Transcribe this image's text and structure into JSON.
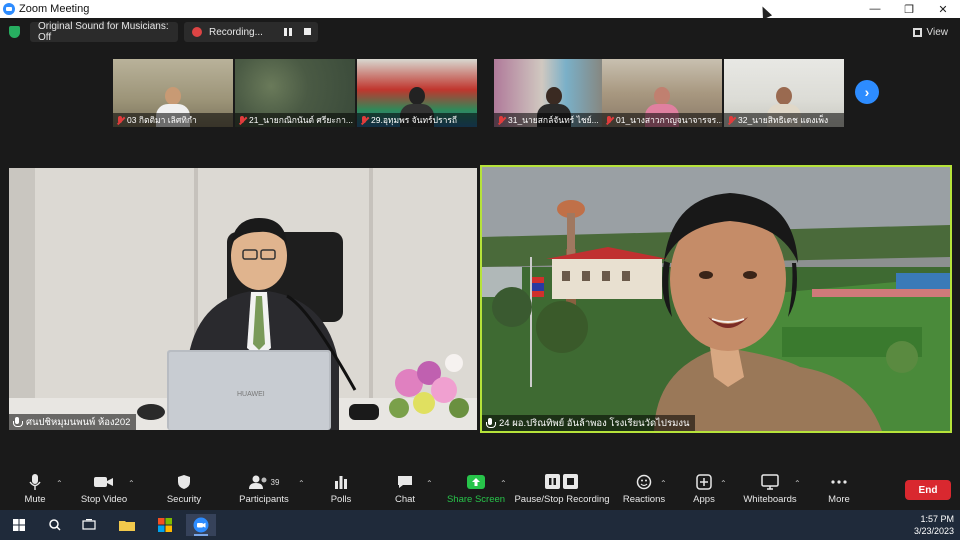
{
  "window": {
    "title": "Zoom Meeting"
  },
  "topbar": {
    "sound_label": "Original Sound for Musicians: Off",
    "recording_label": "Recording...",
    "view_label": "View"
  },
  "thumbnails": [
    {
      "name": "03 กิตติมา เลิศทิกำ"
    },
    {
      "name": "21_นายกณิกนันต์ ศรียะกา..."
    },
    {
      "name": "29.อุทุมพร จันทร์ปรารถี"
    },
    {
      "name": "31_นายสกล์จันทร์ ไชย์..."
    },
    {
      "name": "01_นางสาวกาญจนาจารจร..."
    },
    {
      "name": "32_นายสิทธิเดช แดงเพ็ง"
    }
  ],
  "main_videos": {
    "left": {
      "name": "ศนปชิหมุมนพนพ์ ห้อง202"
    },
    "right": {
      "name": "24 ผอ.ปริณทิพย์ อันล้าพอง โรงเรียนวัดไปรมงน"
    }
  },
  "toolbar": {
    "mute": "Mute",
    "stop_video": "Stop Video",
    "security": "Security",
    "participants": "Participants",
    "participants_count": "39",
    "polls": "Polls",
    "chat": "Chat",
    "share_screen": "Share Screen",
    "pause_stop_recording": "Pause/Stop Recording",
    "reactions": "Reactions",
    "apps": "Apps",
    "whiteboards": "Whiteboards",
    "more": "More",
    "end": "End"
  },
  "taskbar": {
    "time": "1:57 PM",
    "date": "3/23/2023"
  },
  "colors": {
    "accent": "#2d8cff",
    "speaker_border": "#b6e33a",
    "end": "#d9282f",
    "share": "#27c44a"
  }
}
